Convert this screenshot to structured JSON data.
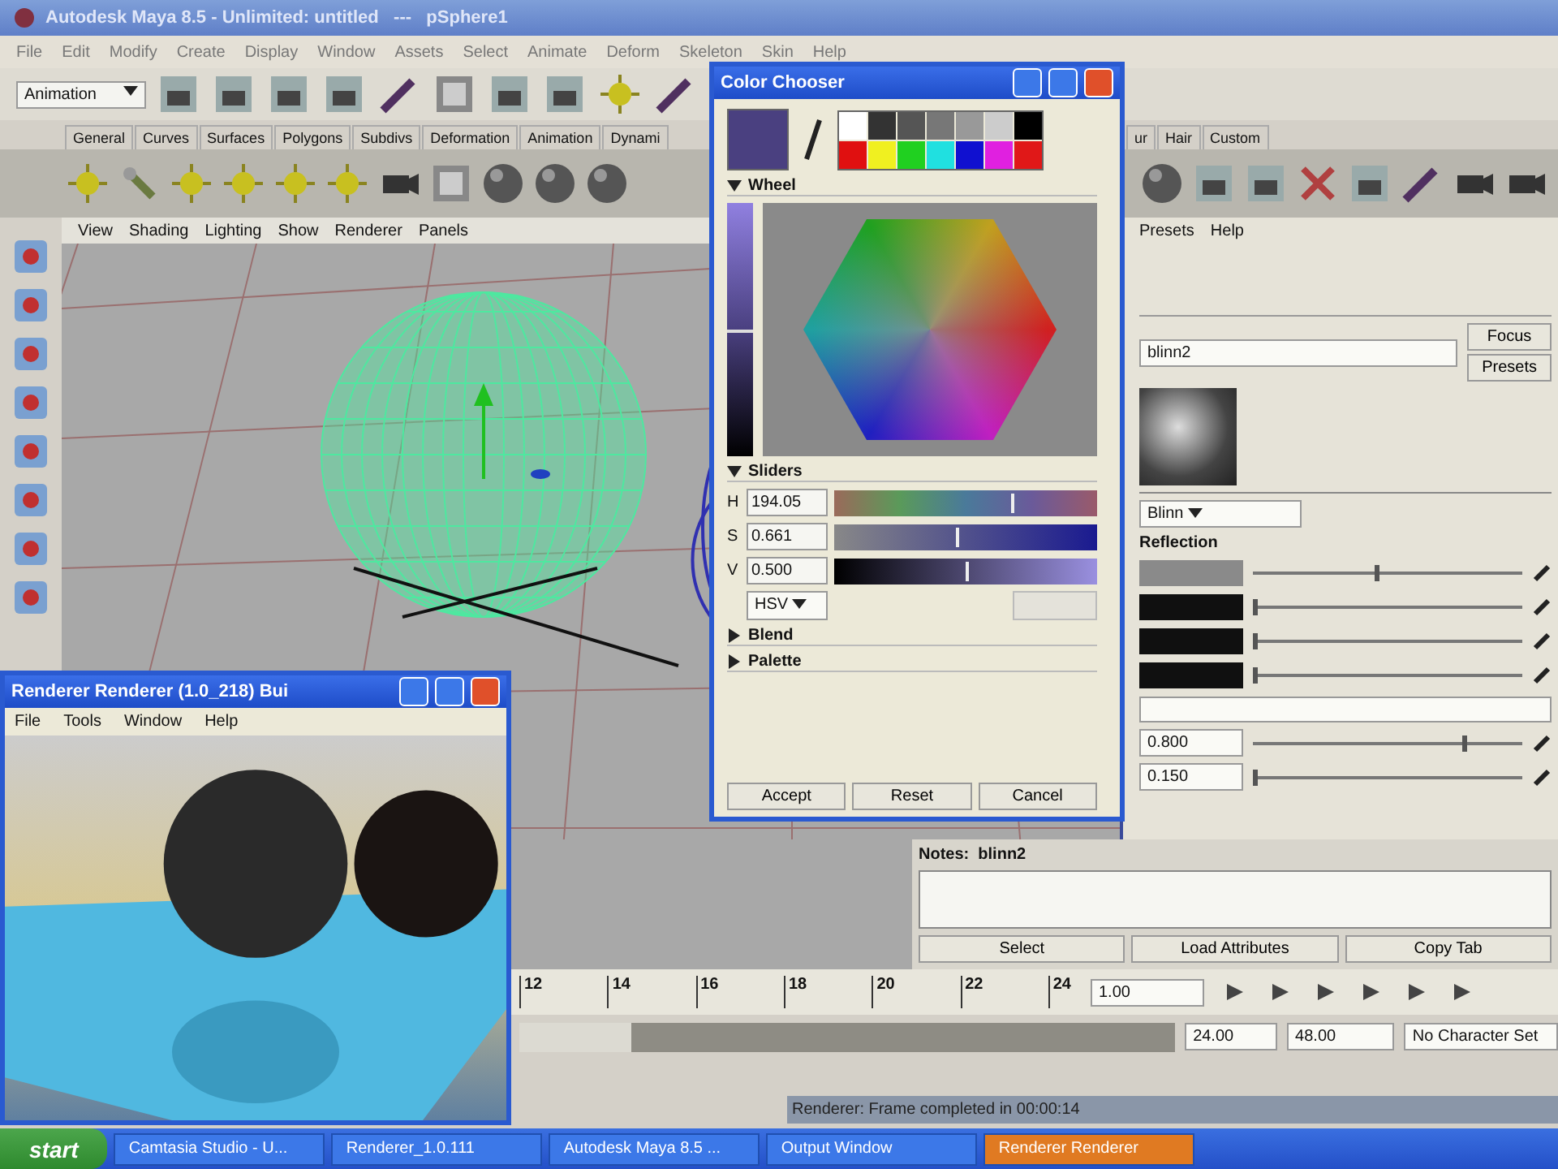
{
  "main_window": {
    "title": "Autodesk Maya 8.5 - Unlimited: untitled   ---   pSphere1"
  },
  "menu_bar": [
    "File",
    "Edit",
    "Modify",
    "Create",
    "Display",
    "Window",
    "Assets",
    "Select",
    "Animate",
    "Deform",
    "Skeleton",
    "Skin",
    "Help"
  ],
  "status_line": {
    "mode": "Animation"
  },
  "shelf_tabs": [
    {
      "label": "General",
      "selected": false
    },
    {
      "label": "Curves",
      "selected": false
    },
    {
      "label": "Surfaces",
      "selected": false
    },
    {
      "label": "Polygons",
      "selected": false
    },
    {
      "label": "Subdivs",
      "selected": false
    },
    {
      "label": "Deformation",
      "selected": false
    },
    {
      "label": "Animation",
      "selected": false
    },
    {
      "label": "Dynami",
      "selected": false
    },
    {
      "label": "ur",
      "selected": false
    },
    {
      "label": "Hair",
      "selected": false
    },
    {
      "label": "Custom",
      "selected": false
    }
  ],
  "viewport": {
    "menu": [
      "View",
      "Shading",
      "Lighting",
      "Show",
      "Renderer",
      "Panels"
    ]
  },
  "attribute_editor": {
    "menu": [
      "Presets",
      "Help"
    ],
    "node_name": "blinn2",
    "buttons": [
      "Focus",
      "Presets"
    ],
    "type": "Blinn",
    "section": "Reflection",
    "rows": [
      {
        "kind": "color",
        "color": "#8a8a8a",
        "level": 0.45
      },
      {
        "kind": "color",
        "color": "#101010",
        "level": 0.0
      },
      {
        "kind": "color",
        "color": "#101010",
        "level": 0.0
      },
      {
        "kind": "color",
        "color": "#101010",
        "level": 0.0
      },
      {
        "kind": "blank"
      },
      {
        "kind": "number",
        "value": "0.800",
        "level": 0.78
      },
      {
        "kind": "number",
        "value": "0.150",
        "level": 0.0
      }
    ]
  },
  "notes": {
    "title": "Notes:  blinn2",
    "buttons": [
      "Select",
      "Load Attributes",
      "Copy Tab"
    ]
  },
  "time_slider": {
    "ticks": [
      "12",
      "14",
      "16",
      "18",
      "20",
      "22",
      "24"
    ],
    "current": "1.00"
  },
  "range_slider": {
    "level": 0.83,
    "start": "24.00",
    "end": "48.00",
    "character_set": "No Character Set"
  },
  "help_line": "Renderer: Frame completed in 00:00:14",
  "color_chooser": {
    "title": "Color Chooser",
    "palette": [
      {
        "color": "#ffffff"
      },
      {
        "color": "#333333"
      },
      {
        "color": "#555555"
      },
      {
        "color": "#777777"
      },
      {
        "color": "#999999"
      },
      {
        "color": "#cccccc"
      },
      {
        "color": "#000000"
      },
      {
        "color": "#e01010"
      },
      {
        "color": "#f0f020"
      },
      {
        "color": "#20d020"
      },
      {
        "color": "#20e0e0"
      },
      {
        "color": "#1010d0"
      },
      {
        "color": "#e020e0"
      },
      {
        "color": "#e01818"
      }
    ],
    "sections": [
      {
        "label": "Wheel",
        "expanded": true
      },
      {
        "label": "Sliders",
        "expanded": true
      },
      {
        "label": "Blend",
        "expanded": false
      },
      {
        "label": "Palette",
        "expanded": false
      }
    ],
    "value_bar": {
      "level": 0.5
    },
    "sliders": [
      {
        "label": "H",
        "value": "194.05",
        "level": 0.67
      },
      {
        "label": "S",
        "value": "0.661",
        "level": 0.46
      },
      {
        "label": "V",
        "value": "0.500",
        "level": 0.5
      }
    ],
    "mode": "HSV",
    "buttons": [
      "Accept",
      "Reset",
      "Cancel"
    ]
  },
  "render_window": {
    "title": "Renderer Renderer (1.0_218) Bui",
    "menu": [
      "File",
      "Tools",
      "Window",
      "Help"
    ]
  },
  "taskbar": {
    "start": "start",
    "items": [
      {
        "label": "Camtasia Studio - U...",
        "selected": false
      },
      {
        "label": "Renderer_1.0.111",
        "selected": false
      },
      {
        "label": "Autodesk Maya 8.5 ...",
        "selected": false
      },
      {
        "label": "Output Window",
        "selected": false
      },
      {
        "label": "Renderer Renderer",
        "selected": true
      }
    ]
  }
}
